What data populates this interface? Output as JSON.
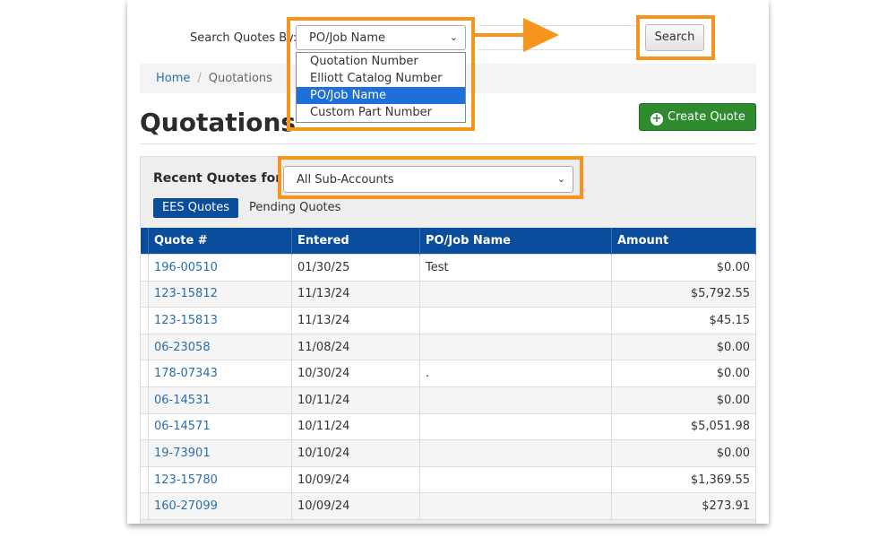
{
  "search": {
    "label": "Search Quotes By:",
    "selected": "PO/Job Name",
    "button": "Search",
    "options": [
      "Quotation Number",
      "Elliott Catalog Number",
      "PO/Job Name",
      "Custom Part Number"
    ]
  },
  "breadcrumb": {
    "home": "Home",
    "separator": "/",
    "current": "Quotations"
  },
  "page_title": "Quotations",
  "create_button": "Create Quote",
  "recent": {
    "label": "Recent Quotes for",
    "subaccount_selected": "All Sub-Accounts",
    "tabs": [
      "EES Quotes",
      "Pending Quotes"
    ]
  },
  "table": {
    "headers": [
      "Quote #",
      "Entered",
      "PO/Job Name",
      "Amount"
    ],
    "rows": [
      [
        "196-00510",
        "01/30/25",
        "Test",
        "$0.00"
      ],
      [
        "123-15812",
        "11/13/24",
        "",
        "$5,792.55"
      ],
      [
        "123-15813",
        "11/13/24",
        "",
        "$45.15"
      ],
      [
        "06-23058",
        "11/08/24",
        "",
        "$0.00"
      ],
      [
        "178-07343",
        "10/30/24",
        ".",
        "$0.00"
      ],
      [
        "06-14531",
        "10/11/24",
        "",
        "$0.00"
      ],
      [
        "06-14571",
        "10/11/24",
        "",
        "$5,051.98"
      ],
      [
        "19-73901",
        "10/10/24",
        "",
        "$0.00"
      ],
      [
        "123-15780",
        "10/09/24",
        "",
        "$1,369.55"
      ],
      [
        "160-27099",
        "10/09/24",
        "",
        "$273.91"
      ]
    ]
  },
  "colors": {
    "accent_blue": "#0a4d9c",
    "create_green": "#2e8b2e",
    "highlight_orange": "#f7941d"
  }
}
